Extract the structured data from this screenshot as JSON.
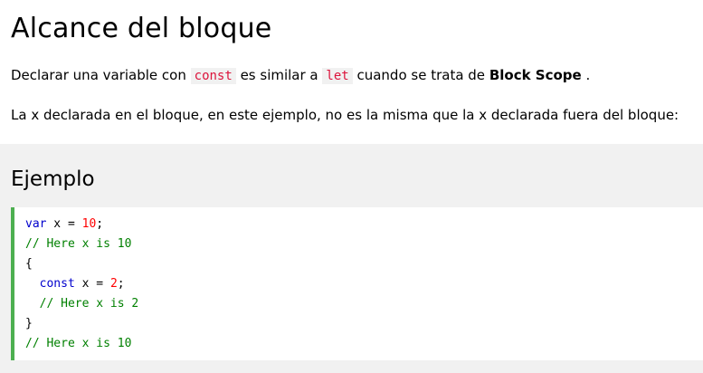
{
  "heading": "Alcance del bloque",
  "para1": {
    "before": "Declarar una variable con ",
    "code1": "const",
    "middle": " es similar a ",
    "code2": "let",
    "after": " cuando se trata de ",
    "bold": "Block Scope",
    "end": " ."
  },
  "para2": "La x declarada en el bloque, en este ejemplo, no es la misma que la x declarada fuera del bloque:",
  "example": {
    "title": "Ejemplo",
    "code": {
      "line1_kw": "var",
      "line1_mid": " x = ",
      "line1_num": "10",
      "line1_end": ";",
      "line2": "// Here x is 10",
      "line3": "{",
      "line4_indent": "  ",
      "line4_kw": "const",
      "line4_mid": " x = ",
      "line4_num": "2",
      "line4_end": ";",
      "line5": "  // Here x is 2",
      "line6": "}",
      "line7": "// Here x is 10"
    }
  },
  "colors": {
    "keyword": "#0000cd",
    "number": "#ff0000",
    "comment": "#008000",
    "inline_code": "#dc143c",
    "accent_border": "#4caf50",
    "example_bg": "#f1f1f1"
  }
}
